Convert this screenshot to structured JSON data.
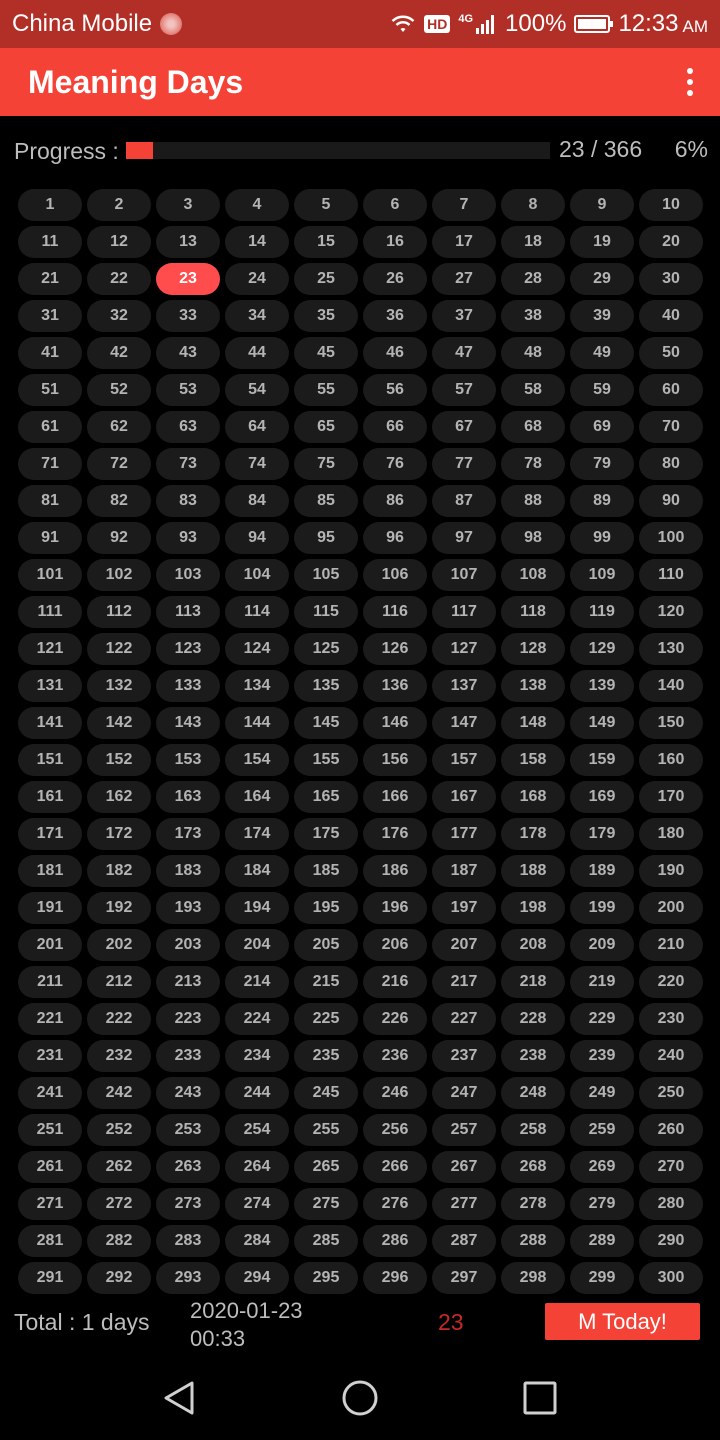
{
  "status_bar": {
    "carrier": "China Mobile",
    "hd": "HD",
    "network": "4G",
    "battery": "100%",
    "time": "12:33",
    "ampm": "AM"
  },
  "app_bar": {
    "title": "Meaning Days"
  },
  "progress": {
    "label": "Progress :",
    "count_text": "23 / 366",
    "percent_text": "6%",
    "fill_fraction": 0.0628
  },
  "grid": {
    "first_day": 1,
    "last_day": 300,
    "columns": 10,
    "today": 23
  },
  "footer": {
    "total": "Total : 1 days",
    "date": "2020-01-23",
    "time": "00:33",
    "today_number": "23",
    "button_label": "M Today!"
  },
  "colors": {
    "accent": "#f44336",
    "status_bar": "#b22f27",
    "cell_bg": "#1b1b1b",
    "today_cell": "#ff4d4d"
  }
}
